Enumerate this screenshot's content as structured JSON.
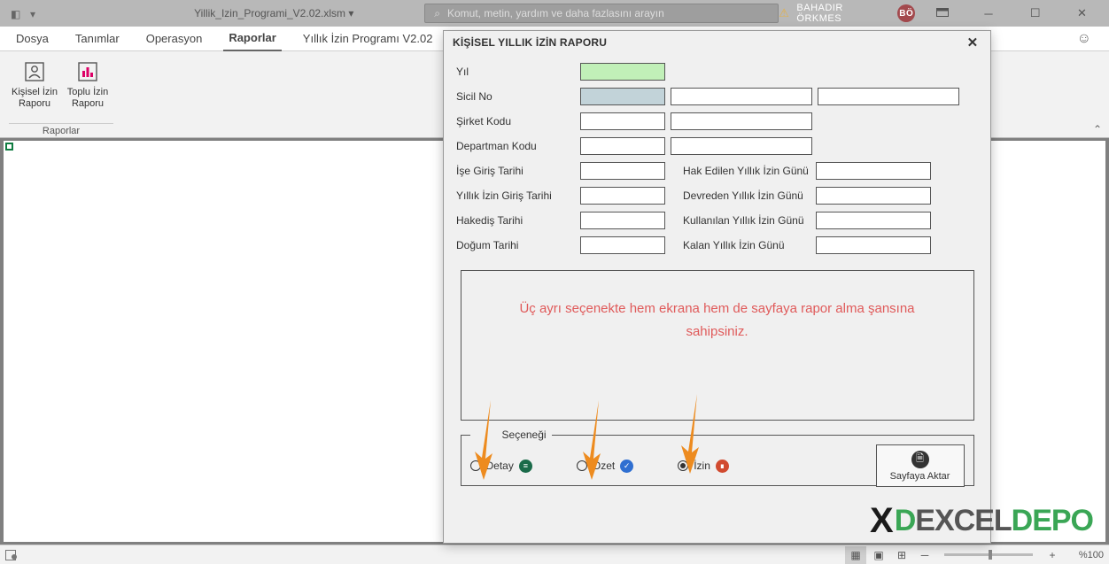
{
  "titlebar": {
    "filename": "Yillik_Izin_Programi_V2.02.xlsm  ▾",
    "search_placeholder": "Komut, metin, yardım ve daha fazlasını arayın",
    "user_name": "BAHADIR ÖRKMES",
    "user_initials": "BÖ"
  },
  "ribbon": {
    "tabs": [
      "Dosya",
      "Tanımlar",
      "Operasyon",
      "Raporlar",
      "Yıllık İzin Programı V2.02"
    ],
    "active_tab": "Raporlar",
    "group_label": "Raporlar",
    "btn1_line1": "Kişisel İzin",
    "btn1_line2": "Raporu",
    "btn2_line1": "Toplu İzin",
    "btn2_line2": "Raporu"
  },
  "dialog": {
    "title": "KİŞİSEL YILLIK İZİN RAPORU",
    "labels": {
      "yil": "Yıl",
      "sicil": "Sicil No",
      "sirket": "Şirket Kodu",
      "departman": "Departman Kodu",
      "ise_giris": "İşe Giriş Tarihi",
      "yillik_giris": "Yıllık İzin Giriş Tarihi",
      "hakedis": "Hakediş Tarihi",
      "dogum": "Doğum Tarihi",
      "hak_edilen": "Hak Edilen Yıllık İzin Günü",
      "devreden": "Devreden Yıllık İzin Günü",
      "kullanilan": "Kullanılan Yıllık İzin Günü",
      "kalan": "Kalan Yıllık İzin Günü"
    },
    "info_text": "Üç ayrı seçenekte hem ekrana hem de sayfaya rapor alma şansına sahipsiniz.",
    "options": {
      "legend_visible": "Seçeneği",
      "opt1": "Detay",
      "opt2": "Özet",
      "opt3": "İzin",
      "selected": 3
    },
    "export_button": "Sayfaya Aktar"
  },
  "statusbar": {
    "zoom": "%100"
  },
  "logo": {
    "x": "X",
    "d": "D",
    "brand1": "EXCEL",
    "brand2": "DEPO"
  }
}
